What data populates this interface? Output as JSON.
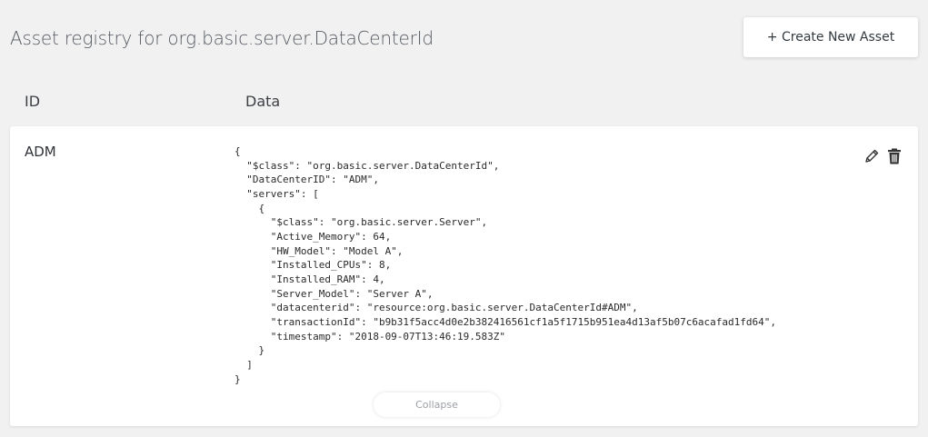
{
  "header": {
    "title": "Asset registry for org.basic.server.DataCenterId",
    "create_button_icon": "plus-icon",
    "create_button_label": "+ Create New Asset"
  },
  "table": {
    "columns": [
      "ID",
      "Data"
    ],
    "rows": [
      {
        "id": "ADM",
        "data": "{\n  \"$class\": \"org.basic.server.DataCenterId\",\n  \"DataCenterID\": \"ADM\",\n  \"servers\": [\n    {\n      \"$class\": \"org.basic.server.Server\",\n      \"Active_Memory\": 64,\n      \"HW_Model\": \"Model A\",\n      \"Installed_CPUs\": 8,\n      \"Installed_RAM\": 4,\n      \"Server_Model\": \"Server A\",\n      \"datacenterid\": \"resource:org.basic.server.DataCenterId#ADM\",\n      \"transactionId\": \"b9b31f5acc4d0e2b382416561cf1a5f1715b951ea4d13af5b07c6acafad1fd64\",\n      \"timestamp\": \"2018-09-07T13:46:19.583Z\"\n    }\n  ]\n}",
        "actions": [
          "pencil-icon",
          "trash-icon"
        ],
        "collapse_label": "Collapse"
      }
    ]
  },
  "colors": {
    "background": "#f1f1f1",
    "card": "#ffffff",
    "icon": "#333333"
  }
}
